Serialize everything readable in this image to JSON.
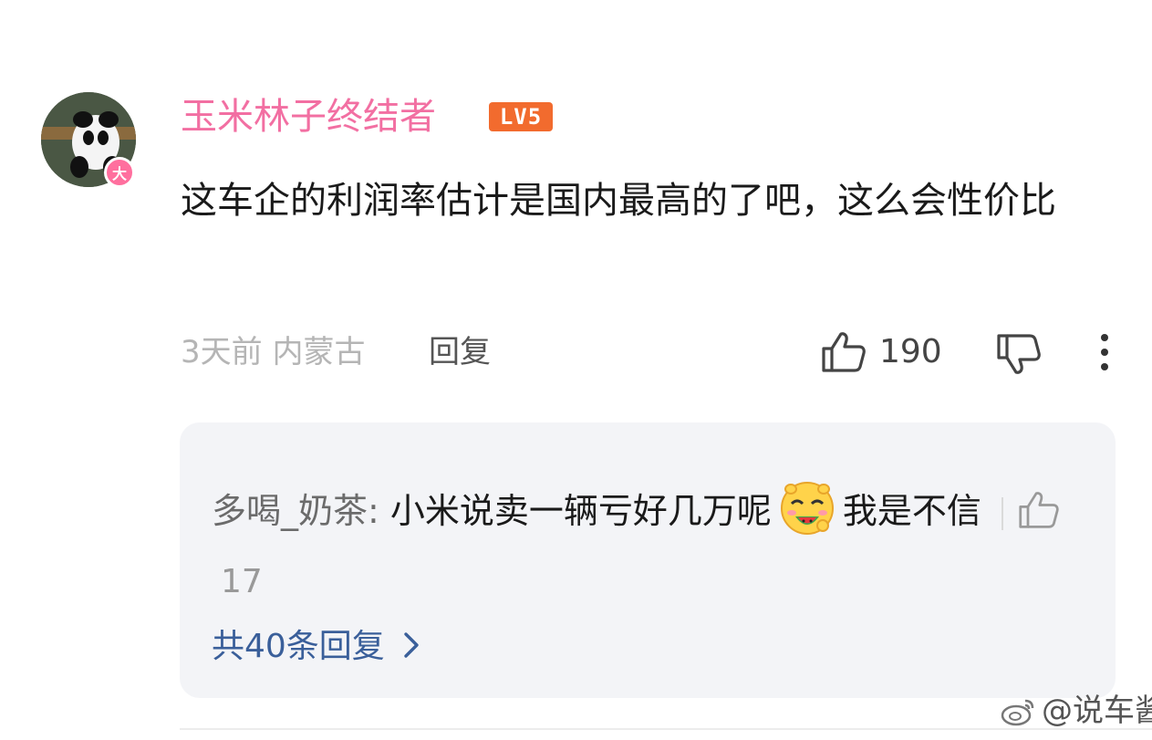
{
  "comment": {
    "avatar_badge": "大",
    "username": "玉米林子终结者",
    "level": "LV5",
    "text": "这车企的利润率估计是国内最高的了吧，这么会性价比",
    "time_location": "3天前 内蒙古",
    "reply_label": "回复",
    "like_count": "190"
  },
  "reply": {
    "author": "多喝_奶茶:",
    "text_before": " 小米说卖一辆亏好几万呢",
    "emoji": "watermelon-eating-face-emoji",
    "text_after": "我是不信",
    "like_count": "17",
    "more_label": "共40条回复"
  },
  "watermark": "@说车酱",
  "colors": {
    "username": "#f26fa2",
    "level_badge": "#f26b2e",
    "link": "#3a5f9a",
    "reply_bg": "#f3f4f7"
  }
}
